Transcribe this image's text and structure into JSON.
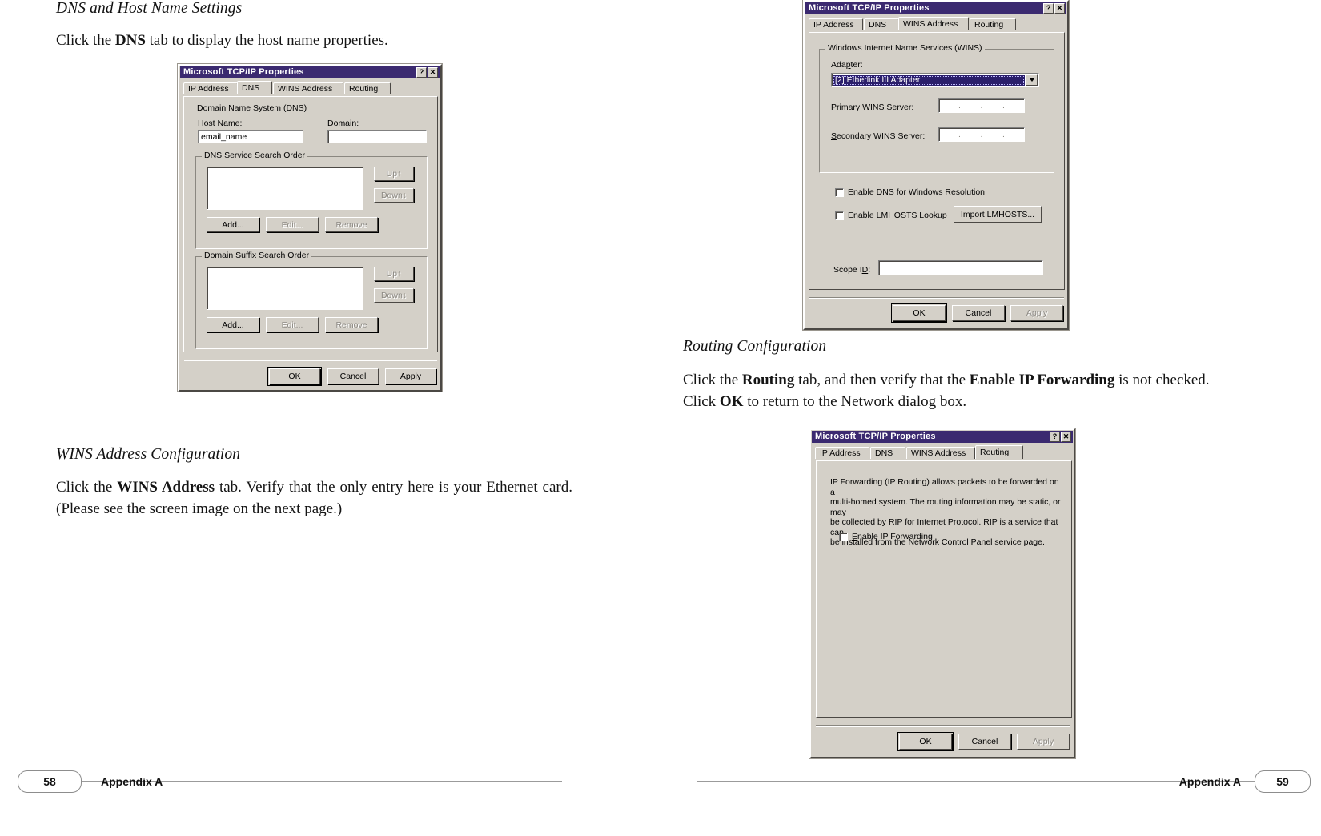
{
  "document": {
    "left_page": {
      "section1_heading": "DNS and Host Name Settings",
      "section1_paragraph_prefix": "Click the ",
      "section1_paragraph_bold": "DNS",
      "section1_paragraph_suffix": " tab to display the host name properties.",
      "section2_heading": "WINS Address Configuration",
      "section2_paragraph_prefix": "Click the ",
      "section2_paragraph_bold": "WINS Address",
      "section2_paragraph_suffix": " tab. Verify that the only entry here is your Ethernet card. (Please see the screen image on the next page.)"
    },
    "right_page": {
      "section1_heading": "Routing Configuration",
      "section1_paragraph_part1": "Click the ",
      "section1_paragraph_bold1": "Routing",
      "section1_paragraph_part2": " tab, and then verify that the ",
      "section1_paragraph_bold2": "Enable IP Forwarding",
      "section1_paragraph_part3": " is not checked. Click ",
      "section1_paragraph_bold3": "OK",
      "section1_paragraph_part4": " to return to the Network dialog box."
    },
    "footer": {
      "left_page_number": "58",
      "left_label": "Appendix A",
      "right_label": "Appendix A",
      "right_page_number": "59"
    }
  },
  "dialog_dns": {
    "title": "Microsoft TCP/IP Properties",
    "titlebar_help_glyph": "?",
    "titlebar_close_glyph": "✕",
    "tabs": [
      {
        "label": "IP Address",
        "active": false
      },
      {
        "label": "DNS",
        "active": true
      },
      {
        "label": "WINS Address",
        "active": false
      },
      {
        "label": "Routing",
        "active": false
      }
    ],
    "group_label": "Domain Name System (DNS)",
    "host_name_label": "Host Name:",
    "host_name_value": "email_name",
    "domain_label": "Domain:",
    "domain_value": "",
    "service_group_label": "DNS Service Search Order",
    "service_items": [],
    "service_up_label": "Up↑",
    "service_down_label": "Down↓",
    "service_add_label": "Add...",
    "service_edit_label": "Edit...",
    "service_remove_label": "Remove",
    "suffix_group_label": "Domain Suffix Search Order",
    "suffix_items": [],
    "suffix_up_label": "Up↑",
    "suffix_down_label": "Down↓",
    "suffix_add_label": "Add...",
    "suffix_edit_label": "Edit...",
    "suffix_remove_label": "Remove",
    "ok_label": "OK",
    "cancel_label": "Cancel",
    "apply_label": "Apply"
  },
  "dialog_wins": {
    "title": "Microsoft TCP/IP Properties",
    "titlebar_help_glyph": "?",
    "titlebar_close_glyph": "✕",
    "tabs": [
      {
        "label": "IP Address",
        "active": false
      },
      {
        "label": "DNS",
        "active": false
      },
      {
        "label": "WINS Address",
        "active": true
      },
      {
        "label": "Routing",
        "active": false
      }
    ],
    "group_label": "Windows Internet Name Services (WINS)",
    "adapter_label": "Adapter:",
    "adapter_value": "[2]          Etherlink III Adapter",
    "primary_label": "Primary WINS Server:",
    "primary_value": [
      ".",
      ".",
      "."
    ],
    "secondary_label": "Secondary WINS Server:",
    "secondary_value": [
      ".",
      ".",
      "."
    ],
    "enable_dns_label": "Enable DNS for Windows Resolution",
    "enable_dns_checked": false,
    "enable_lmhosts_label": "Enable LMHOSTS Lookup",
    "enable_lmhosts_checked": false,
    "import_lmhosts_label": "Import LMHOSTS...",
    "scope_id_label": "Scope ID:",
    "scope_id_value": "",
    "ok_label": "OK",
    "cancel_label": "Cancel",
    "apply_label": "Apply"
  },
  "dialog_routing": {
    "title": "Microsoft TCP/IP Properties",
    "titlebar_help_glyph": "?",
    "titlebar_close_glyph": "✕",
    "tabs": [
      {
        "label": "IP Address",
        "active": false
      },
      {
        "label": "DNS",
        "active": false
      },
      {
        "label": "WINS Address",
        "active": false
      },
      {
        "label": "Routing",
        "active": true
      }
    ],
    "description": "IP Forwarding (IP Routing) allows packets to be forwarded on a\nmulti-homed system.  The routing information may be static, or may\nbe collected by RIP for Internet Protocol. RIP is a service that can\nbe installed from the Network Control Panel service page.",
    "enable_ip_forwarding_label": "Enable IP Forwarding",
    "enable_ip_forwarding_checked": false,
    "ok_label": "OK",
    "cancel_label": "Cancel",
    "apply_label": "Apply"
  },
  "colors": {
    "titlebar": "#3b2a70",
    "dialog_face": "#d4d0c8",
    "selection": "#2b1f6b",
    "text": "#000000"
  }
}
